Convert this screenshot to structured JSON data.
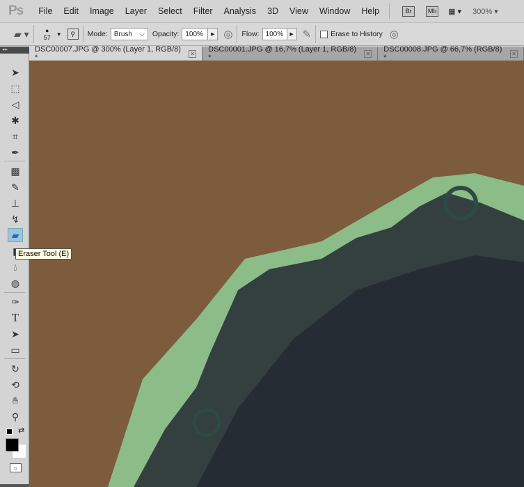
{
  "app": {
    "logo": "Ps"
  },
  "menu": [
    "File",
    "Edit",
    "Image",
    "Layer",
    "Select",
    "Filter",
    "Analysis",
    "3D",
    "View",
    "Window",
    "Help"
  ],
  "appbar": {
    "bridge": "Br",
    "minibridge": "Mb",
    "zoom": "300%"
  },
  "options": {
    "brush_size": "57",
    "mode_label": "Mode:",
    "mode_value": "Brush",
    "opacity_label": "Opacity:",
    "opacity_value": "100%",
    "flow_label": "Flow:",
    "flow_value": "100%",
    "erase_history_label": "Erase to History",
    "erase_history_checked": false
  },
  "tabs": [
    {
      "label": "DSC00007.JPG @ 300% (Layer 1, RGB/8) *",
      "active": true
    },
    {
      "label": "DSC00001.JPG @ 16,7% (Layer 1, RGB/8) *",
      "active": false
    },
    {
      "label": "DSC00008.JPG @ 66,7% (RGB/8) *",
      "active": false
    }
  ],
  "tooltip": "Eraser Tool (E)",
  "colors": {
    "foreground": "#000000",
    "background": "#ffffff",
    "canvas_bg": "#7c5c3d",
    "halo": "#8fbf8a",
    "hair": "#2f3a3e"
  }
}
